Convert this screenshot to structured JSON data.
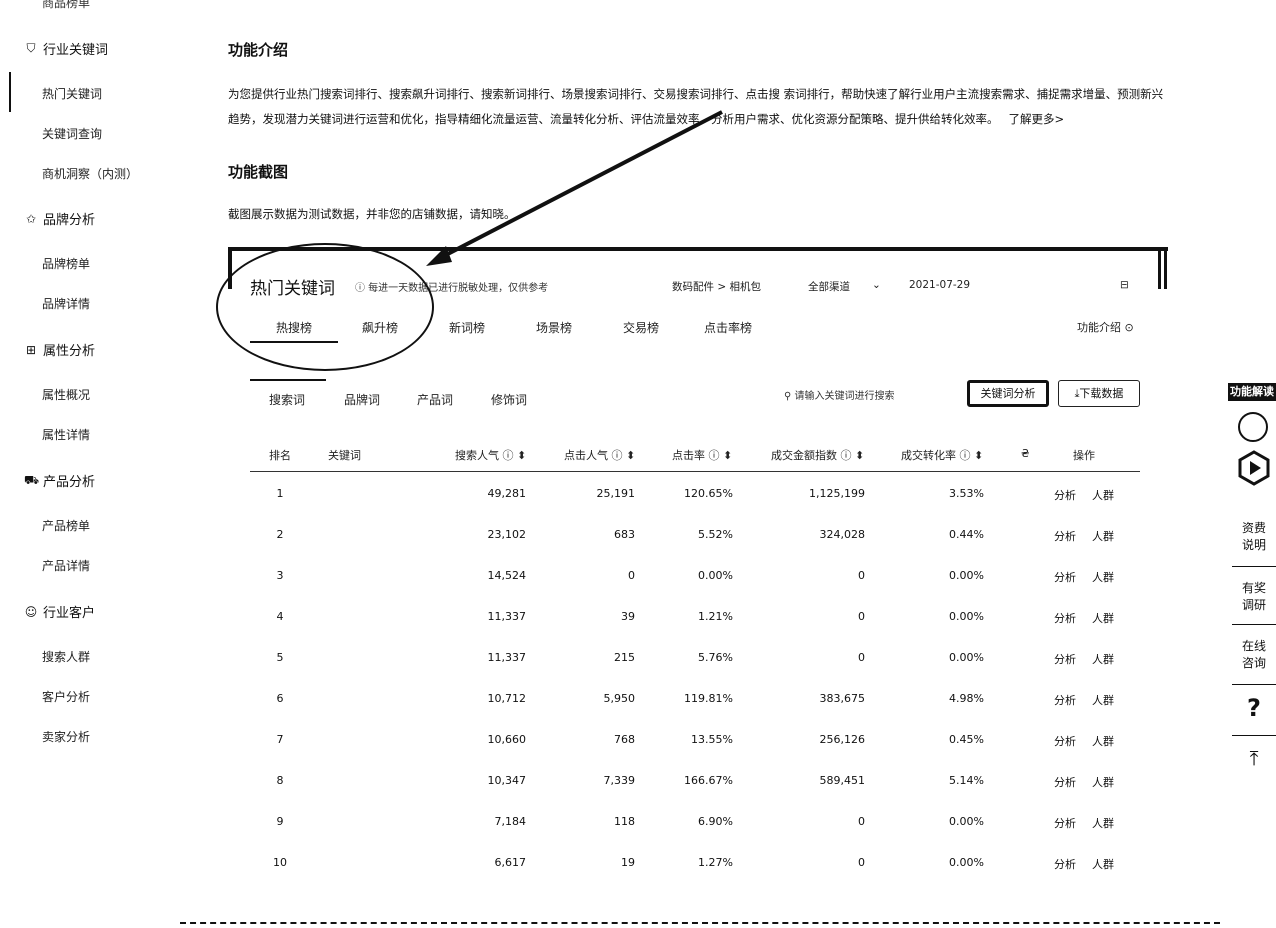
{
  "sidebar": {
    "top_item": "商品榜单",
    "groups": [
      {
        "icon": "shield-icon",
        "glyph": "⛉",
        "label": "行业关键词",
        "items": [
          "热门关键词",
          "关键词查询",
          "商机洞察（内测）"
        ]
      },
      {
        "icon": "star-icon",
        "glyph": "✩",
        "label": "品牌分析",
        "items": [
          "品牌榜单",
          "品牌详情"
        ]
      },
      {
        "icon": "grid-icon",
        "glyph": "⊞",
        "label": "属性分析",
        "items": [
          "属性概况",
          "属性详情"
        ]
      },
      {
        "icon": "cart-icon",
        "glyph": "⛟",
        "label": "产品分析",
        "items": [
          "产品榜单",
          "产品详情"
        ]
      },
      {
        "icon": "user-icon",
        "glyph": "☺",
        "label": "行业客户",
        "items": [
          "搜索人群",
          "客户分析",
          "卖家分析"
        ]
      }
    ]
  },
  "article": {
    "intro_title": "功能介绍",
    "intro_text": "为您提供行业热门搜索词排行、搜索飙升词排行、搜索新词排行、场景搜索词排行、交易搜索词排行、点击搜 索词排行，帮助快速了解行业用户主流搜索需求、捕捉需求增量、预测新兴趋势，发现潜力关键词进行运营和优化，指导精细化流量运营、流量转化分析、评估流量效率，分析用户需求、优化资源分配策略、提升供给转化效率。",
    "learn_more": "了解更多>",
    "shot_title": "功能截图",
    "shot_note": "截图展示数据为测试数据，并非您的店铺数据，请知晓。"
  },
  "panel": {
    "title": "热门关键词",
    "hint": "ⓘ 每进一天数据已进行脱敏处理，仅供参考",
    "filter_category": "数码配件 > 相机包",
    "filter_channel": "全部渠道",
    "filter_channel_arrow": "⌄",
    "date": "2021-07-29",
    "calendar_icon": "⊟",
    "tabs": [
      "热搜榜",
      "飙升榜",
      "新词榜",
      "场景榜",
      "交易榜",
      "点击率榜"
    ],
    "help": "功能介绍 ⊙",
    "subtabs": [
      "搜索词",
      "品牌词",
      "产品词",
      "修饰词"
    ],
    "search_placeholder": "⚲ 请输入关键词进行搜索",
    "analyze_button": "关键词分析",
    "download_button": "⤓下载数据",
    "columns": [
      "排名",
      "关键词",
      "搜索人气 ⓘ ⬍",
      "点击人气 ⓘ ⬍",
      "点击率 ⓘ ⬍",
      "成交金额指数 ⓘ ⬍",
      "成交转化率 ⓘ ⬍",
      "₴",
      "操作"
    ],
    "rows": [
      {
        "rank": "1",
        "search": "49,281",
        "click": "25,191",
        "ctr": "120.65%",
        "gmv": "1,125,199",
        "cvr": "3.53%"
      },
      {
        "rank": "2",
        "search": "23,102",
        "click": "683",
        "ctr": "5.52%",
        "gmv": "324,028",
        "cvr": "0.44%"
      },
      {
        "rank": "3",
        "search": "14,524",
        "click": "0",
        "ctr": "0.00%",
        "gmv": "0",
        "cvr": "0.00%"
      },
      {
        "rank": "4",
        "search": "11,337",
        "click": "39",
        "ctr": "1.21%",
        "gmv": "0",
        "cvr": "0.00%"
      },
      {
        "rank": "5",
        "search": "11,337",
        "click": "215",
        "ctr": "5.76%",
        "gmv": "0",
        "cvr": "0.00%"
      },
      {
        "rank": "6",
        "search": "10,712",
        "click": "5,950",
        "ctr": "119.81%",
        "gmv": "383,675",
        "cvr": "4.98%"
      },
      {
        "rank": "7",
        "search": "10,660",
        "click": "768",
        "ctr": "13.55%",
        "gmv": "256,126",
        "cvr": "0.45%"
      },
      {
        "rank": "8",
        "search": "10,347",
        "click": "7,339",
        "ctr": "166.67%",
        "gmv": "589,451",
        "cvr": "5.14%"
      },
      {
        "rank": "9",
        "search": "7,184",
        "click": "118",
        "ctr": "6.90%",
        "gmv": "0",
        "cvr": "0.00%"
      },
      {
        "rank": "10",
        "search": "6,617",
        "click": "19",
        "ctr": "1.27%",
        "gmv": "0",
        "cvr": "0.00%"
      }
    ],
    "action_analyze": "分析",
    "action_crowd": "人群"
  },
  "right_toolbar": {
    "badge": "功能解读",
    "items": [
      "资费说明",
      "有奖调研",
      "在线咨询"
    ],
    "help": "?",
    "back_to_top": "⤒"
  }
}
